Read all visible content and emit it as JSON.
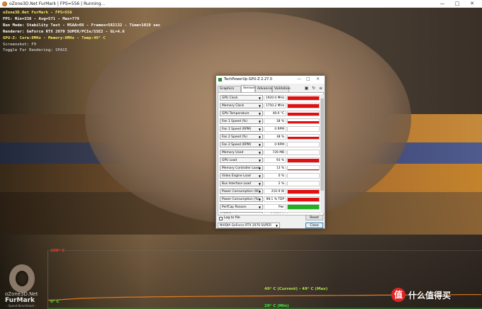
{
  "furmark": {
    "window_title": "oZone3D.Net FurMark | FPS=556 | Running...",
    "overlay": [
      {
        "text": "oZone3D.Net FurMark - FPS=556",
        "color": "yellow"
      },
      {
        "text": "FPS: Min=338 - Avg=571 - Max=779",
        "color": "white"
      },
      {
        "text": "Run Mode: Stability Test - MSAA=0X - Frames=582132 - Time=1019 sec",
        "color": "white"
      },
      {
        "text": "Renderer: GeForce RTX 2070 SUPER/PCIe/SSE2 - GL=4.6",
        "color": "white"
      },
      {
        "text": "GPU-Z: Core:0MHz - Memory:0MHz - Temp:49° C",
        "color": "yellow"
      },
      {
        "text": "Screenshot: F9",
        "color": "grey"
      },
      {
        "text": "Toggle Fur Rendering: SPACE",
        "color": "grey"
      }
    ],
    "graph": {
      "top_label": "100° C",
      "bottom_label": "0° C",
      "current_label": "49° C (Current) - 49° C (Max)",
      "avg_label": "29° C (Min)",
      "temp_max": 100,
      "temp_series": [
        28,
        29,
        31,
        33,
        35,
        36,
        37,
        38,
        38.5,
        39,
        39.5,
        40,
        40.5,
        41,
        41.2,
        41.5,
        41.8,
        42,
        42.2,
        42.5,
        42.8,
        43,
        43.2,
        43.5,
        43.8,
        44,
        44.2,
        44.5,
        44.7,
        45,
        45.2,
        45.4,
        45.6,
        45.8,
        46,
        46.2,
        46.4,
        46.6,
        46.8,
        47,
        47.2,
        47.4,
        47.6,
        47.8,
        48,
        48.2,
        48.4,
        48.6,
        48.8,
        49,
        49,
        49
      ]
    },
    "logo": {
      "line1": "oZone3D.Net",
      "line2": "FurMark",
      "line3": "- Speed Benchmark -"
    }
  },
  "watermark": {
    "badge": "值",
    "text": "什么值得买"
  },
  "gpuz": {
    "title": "TechPowerUp GPU-Z 2.27.0",
    "tabs": [
      "Graphics Card",
      "Sensors",
      "Advanced",
      "Validation"
    ],
    "active_tab": 1,
    "sensor_color": "#e01010",
    "perfcap_color": "#20b020",
    "sensors": [
      {
        "label": "GPU Clock",
        "value": "1920.0 MHz",
        "level": 0.85,
        "kind": "red"
      },
      {
        "label": "Memory Clock",
        "value": "1750.2 MHz",
        "level": 0.85,
        "kind": "red"
      },
      {
        "label": "GPU Temperature",
        "value": "49.0 °C",
        "level": 0.7,
        "kind": "red"
      },
      {
        "label": "Fan 1 Speed (%)",
        "value": "38 %",
        "level": 0.5,
        "kind": "red"
      },
      {
        "label": "Fan 1 Speed (RPM)",
        "value": "0 RPM",
        "level": 0,
        "kind": "red"
      },
      {
        "label": "Fan 2 Speed (%)",
        "value": "38 %",
        "level": 0.5,
        "kind": "red"
      },
      {
        "label": "Fan 2 Speed (RPM)",
        "value": "0 RPM",
        "level": 0,
        "kind": "red"
      },
      {
        "label": "Memory Used",
        "value": "726 MB",
        "level": 0.08,
        "kind": "red"
      },
      {
        "label": "GPU Load",
        "value": "93 %",
        "level": 0.9,
        "kind": "red"
      },
      {
        "label": "Memory Controller Load",
        "value": "13 %",
        "level": 0.12,
        "kind": "red"
      },
      {
        "label": "Video Engine Load",
        "value": "0 %",
        "level": 0,
        "kind": "red"
      },
      {
        "label": "Bus Interface Load",
        "value": "2 %",
        "level": 0.04,
        "kind": "red"
      },
      {
        "label": "Power Consumption (W)",
        "value": "210.9 W",
        "level": 0.85,
        "kind": "red"
      },
      {
        "label": "Power Consumption (%)",
        "value": "98.1 % TDP",
        "level": 0.85,
        "kind": "red"
      },
      {
        "label": "PerfCap Reason",
        "value": "Pwr",
        "level": 1,
        "kind": "green"
      },
      {
        "label": "VDDC",
        "value": "0.9810 V",
        "level": 0.5,
        "kind": "red"
      }
    ],
    "log_label": "Log to file",
    "reset_label": "Reset",
    "gpu_select": "NVIDIA GeForce RTX 2070 SUPER",
    "close_label": "Close"
  }
}
